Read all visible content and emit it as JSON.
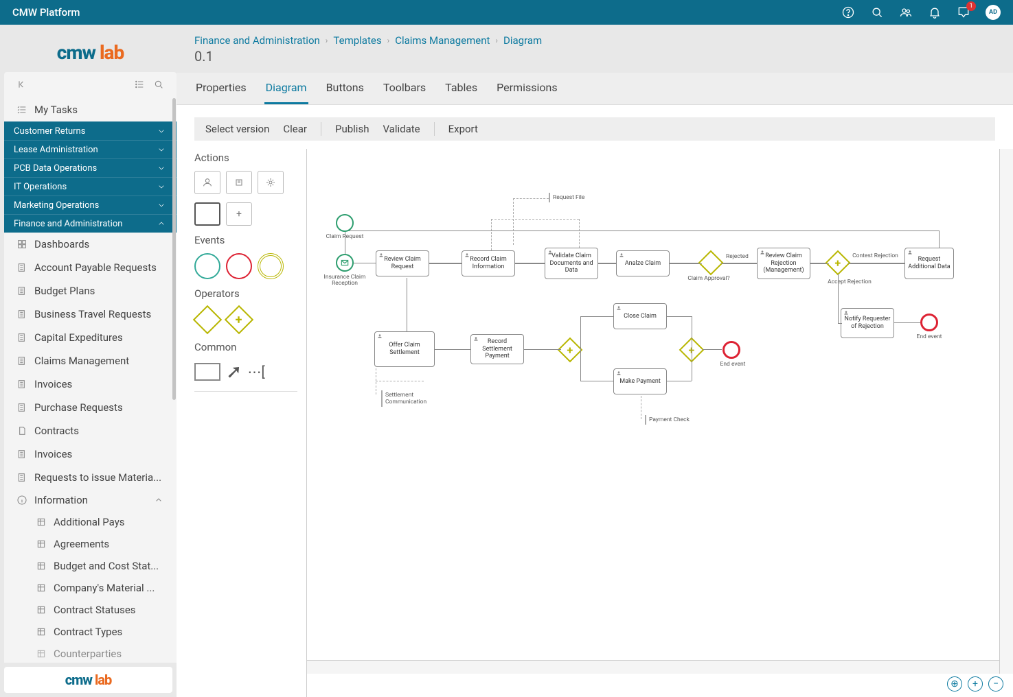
{
  "header": {
    "title": "CMW Platform",
    "notification_count": "1",
    "avatar_initials": "AD"
  },
  "logo": {
    "brand": "cmw",
    "suffix": "lab"
  },
  "breadcrumb": {
    "items": [
      "Finance and Administration",
      "Templates",
      "Claims Management",
      "Diagram"
    ],
    "version": "0.1"
  },
  "tabs": {
    "items": [
      "Properties",
      "Diagram",
      "Buttons",
      "Toolbars",
      "Tables",
      "Permissions"
    ],
    "active": "Diagram"
  },
  "toolbar": {
    "select_version": "Select version",
    "clear": "Clear",
    "publish": "Publish",
    "validate": "Validate",
    "export": "Export"
  },
  "sidebar": {
    "my_tasks": "My Tasks",
    "groups": [
      {
        "label": "Customer Returns",
        "expanded": false
      },
      {
        "label": "Lease Administration",
        "expanded": false
      },
      {
        "label": "PCB Data Operations",
        "expanded": false
      },
      {
        "label": "IT Operations",
        "expanded": false
      },
      {
        "label": "Marketing Operations",
        "expanded": false
      },
      {
        "label": "Finance and Administration",
        "expanded": true
      }
    ],
    "finance_items": [
      "Dashboards",
      "Account Payable Requests",
      "Budget Plans",
      "Business Travel Requests",
      "Capital Expeditures",
      "Claims Management",
      "Invoices",
      "Purchase Requests",
      "Contracts",
      "Invoices",
      "Requests to issue Materia..."
    ],
    "information": {
      "label": "Information",
      "items": [
        "Additional Pays",
        "Agreements",
        "Budget and Cost Stat...",
        "Company's Material ...",
        "Contract Statuses",
        "Contract Types",
        "Counterparties"
      ]
    }
  },
  "palette": {
    "actions": "Actions",
    "events": "Events",
    "operators": "Operators",
    "common": "Common"
  },
  "diagram": {
    "nodes": {
      "claim_request": "Claim Request",
      "insurance_claim_reception": "Insurance Claim Reception",
      "review_claim_request": "Review Claim Request",
      "record_claim_information": "Record Claim Information",
      "validate_claim_docs_data": "Validate Claim Documents and Data",
      "analze_claim": "Analze Claim",
      "review_claim_rejection": "Review Claim Rejection (Management)",
      "request_additional_data": "Request Additional Data",
      "offer_claim_settlement": "Offer Claim Settlement",
      "record_settlement_payment": "Record Settlement Payment",
      "close_claim": "Close Claim",
      "make_payment": "Make Payment",
      "notify_requester_of_rejection": "Notify Requester of Rejection",
      "end_event": "End event",
      "claim_approval": "Claim Approval?",
      "rejected": "Rejected",
      "contest_rejection": "Contest Rejection",
      "accept_rejection": "Accept Rejection"
    },
    "notes": {
      "request_file": "Request File",
      "settlement_communication": "Settlement Communication",
      "payment_check": "Payment Check"
    }
  }
}
